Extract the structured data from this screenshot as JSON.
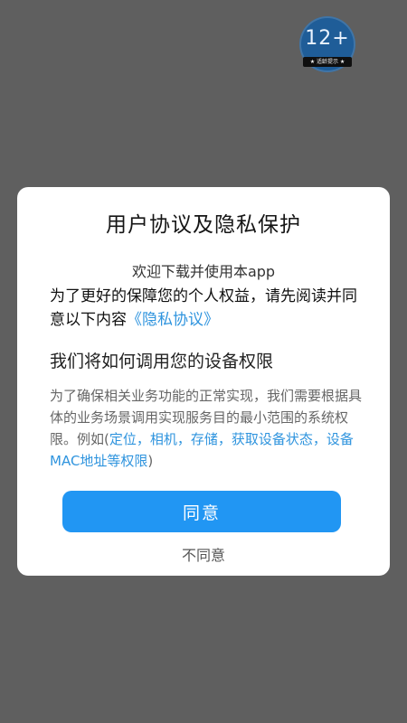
{
  "badge": {
    "age": "12+",
    "caption": "★ 适龄提示 ★"
  },
  "dialog": {
    "title": "用户协议及隐私保护",
    "welcome": "欢迎下载并使用本app",
    "intro_text": "为了更好的保障您的个人权益，请先阅读并同意以下内容",
    "privacy_link": "《隐私协议》",
    "section_title": "我们将如何调用您的设备权限",
    "desc_text": "为了确保相关业务功能的正常实现，我们需要根据具体的业务场景调用实现服务目的最小范围的系统权限。例如(",
    "permissions_text": "定位，相机，存储，获取设备状态，设备MAC地址等权限",
    "desc_tail": ")",
    "agree_label": "同意",
    "disagree_label": "不同意"
  },
  "colors": {
    "overlay": "#5f5f5f",
    "link": "#2f94de",
    "primary_button": "#2196f3",
    "badge": "#1f5d98"
  }
}
